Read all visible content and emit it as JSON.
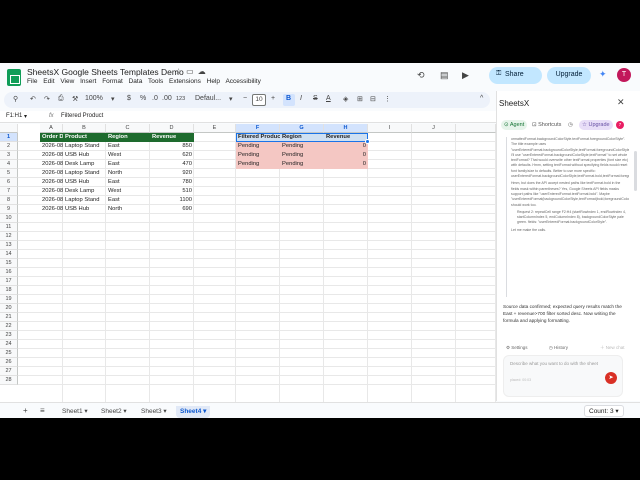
{
  "title": "SheetsX Google Sheets Templates Demo",
  "title_icons": [
    "star-icon",
    "move-to-folder-icon",
    "cloud-status-icon"
  ],
  "menu": [
    "File",
    "Edit",
    "View",
    "Insert",
    "Format",
    "Data",
    "Tools",
    "Extensions",
    "Help",
    "Accessibility"
  ],
  "header_actions": {
    "share": "Share",
    "upgrade": "Upgrade",
    "avatar": "T"
  },
  "toolbar": {
    "zoom": "100%",
    "currency": "$",
    "percent": "%",
    "dec_decrease": ".0",
    "dec_increase": ".00",
    "number_format": "123",
    "font": "Defaul...",
    "font_size": "10",
    "bold": "B",
    "italic": "I",
    "strike": "S",
    "text_color": "A"
  },
  "formula_bar": {
    "name_box": "F1:H1",
    "fx": "fx",
    "content": "Filtered Product"
  },
  "grid": {
    "columns": [
      "A",
      "B",
      "C",
      "D",
      "E",
      "F",
      "G",
      "H",
      "I",
      "J"
    ],
    "selected_columns": [
      "F",
      "G",
      "H"
    ],
    "rows": [
      "1",
      "2",
      "3",
      "4",
      "5",
      "6",
      "7",
      "8",
      "9",
      "10",
      "11",
      "12",
      "13",
      "14",
      "15",
      "16",
      "17",
      "18",
      "19",
      "20",
      "21",
      "22",
      "23",
      "24",
      "25",
      "26",
      "27",
      "28"
    ],
    "selected_row": "1",
    "data_headers": [
      "Order Date",
      "Product",
      "Region",
      "Revenue"
    ],
    "data_rows": [
      [
        "2026-08-01",
        "Laptop Stand",
        "East",
        "850"
      ],
      [
        "2026-08-02",
        "USB Hub",
        "West",
        "620"
      ],
      [
        "2026-08-03",
        "Desk Lamp",
        "East",
        "470"
      ],
      [
        "2026-08-04",
        "Laptop Stand",
        "North",
        "920"
      ],
      [
        "2026-08-05",
        "USB Hub",
        "East",
        "780"
      ],
      [
        "2026-08-06",
        "Desk Lamp",
        "West",
        "510"
      ],
      [
        "2026-08-07",
        "Laptop Stand",
        "East",
        "1100"
      ],
      [
        "2026-08-08",
        "USB Hub",
        "North",
        "690"
      ]
    ],
    "filter_headers": [
      "Filtered Product",
      "Region",
      "Revenue"
    ],
    "filter_rows": [
      [
        "Pending",
        "Pending",
        "0"
      ],
      [
        "Pending",
        "Pending",
        "0"
      ],
      [
        "Pending",
        "Pending",
        "0"
      ]
    ],
    "colors": {
      "header_green": "#1e6b2e",
      "filter_header_blue": "#cfe0f2",
      "pending_red": "#f4c7c3"
    }
  },
  "sheets": {
    "tabs": [
      "Sheet1",
      "Sheet2",
      "Sheet3",
      "Sheet4"
    ],
    "active": "Sheet4",
    "count": "Count: 3"
  },
  "panel": {
    "title": "SheetsX",
    "tabs": [
      "Agent",
      "Shortcuts",
      "Upgrade"
    ],
    "badge": "7",
    "reasoning": [
      "ormattedFormat.backgroundColorStyle.textFormat.foregroundColorStyle\". The title example uses \"userEnteredFormat.backgroundColorStyle,textFormat.foregroundColorStyle,textFormat.bold,horizontalAlignment\" I'll use \"userEnteredFormat.backgroundColorStyle,textFormat\" to set whole textFormat? That would overwrite other textFormat properties (font size etc) with defaults. Hmm, setting textFormat without specifying fields would reset font family/size to defaults. Better to use more specific: userEnteredFormat.backgroundColorStyle,textFormat.bold,textFormat.foregroundColorStyle\".",
      "Hmm, but does the API accept nested paths like textFormat.bold in the fields mask within parentheses? Yes, Google Sheets API fields masks support paths like \"userEnteredFormat.textFormat.bold\". Maybe \"userEnteredFormat(backgroundColorStyle,textFormat(bold,foregroundColorStyle))\" should work too.",
      "Request 2: repeatCell range F2:H4 (startRowIndex 1, endRowIndex 4, startColumnIndex 5, endColumnIndex 8), backgroundColorStyle pale green. fields: \"userEnteredFormat.backgroundColorStyle\".",
      "Let me make the calls."
    ],
    "answer": "Source data confirmed; expected query results match the East + revenue>700 filter sorted desc. Now writing the formula and applying formatting.",
    "actions": [
      "Settings",
      "History"
    ],
    "new_chat": "New chat",
    "input_placeholder": "Describe what you want to do with the sheet",
    "input_meta": "placed: 00:03"
  }
}
